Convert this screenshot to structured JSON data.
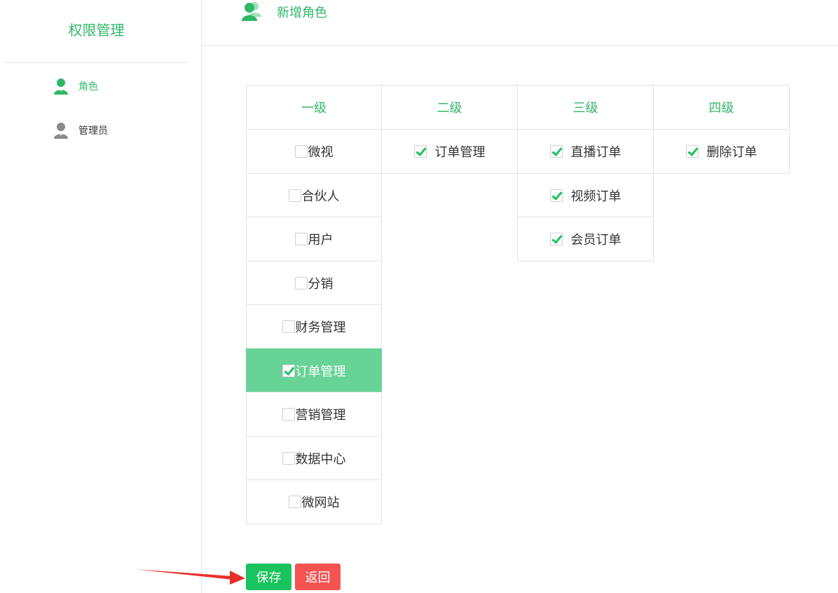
{
  "sidebar": {
    "title": "权限管理",
    "items": [
      {
        "label": "角色",
        "icon": "user-icon",
        "color": "#2fb867",
        "active": true
      },
      {
        "label": "管理员",
        "icon": "admin-user-icon",
        "color": "#8a8a8a",
        "active": false
      }
    ]
  },
  "header": {
    "title": "新增角色",
    "icon": "users-icon"
  },
  "table": {
    "headers": [
      "一级",
      "二级",
      "三级",
      "四级"
    ],
    "level1": [
      {
        "label": "微视",
        "checked": false
      },
      {
        "label": "合伙人",
        "checked": false
      },
      {
        "label": "用户",
        "checked": false
      },
      {
        "label": "分销",
        "checked": false
      },
      {
        "label": "财务管理",
        "checked": false
      },
      {
        "label": "订单管理",
        "checked": true,
        "active": true
      },
      {
        "label": "营销管理",
        "checked": false
      },
      {
        "label": "数据中心",
        "checked": false
      },
      {
        "label": "微网站",
        "checked": false
      }
    ],
    "level2": [
      {
        "label": "订单管理",
        "checked": true
      }
    ],
    "level3": [
      {
        "label": "直播订单",
        "checked": true
      },
      {
        "label": "视频订单",
        "checked": true
      },
      {
        "label": "会员订单",
        "checked": true
      }
    ],
    "level4": [
      {
        "label": "删除订单",
        "checked": true
      }
    ]
  },
  "actions": {
    "save_label": "保存",
    "back_label": "返回"
  },
  "colors": {
    "accent": "#2fb867",
    "save": "#19c35d",
    "back": "#f55252",
    "active_row": "#67d397",
    "arrow": "#e8302a"
  }
}
